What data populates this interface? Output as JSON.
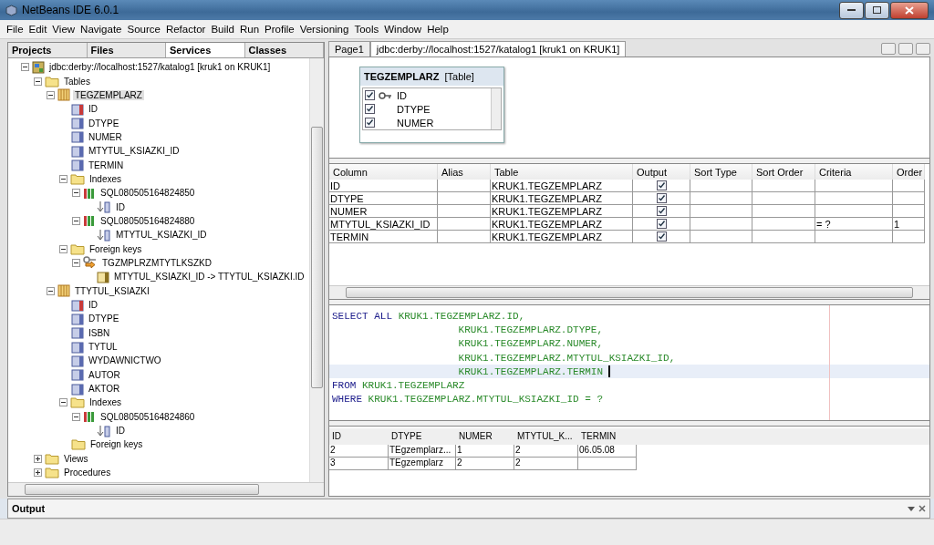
{
  "window": {
    "title": "NetBeans IDE 6.0.1"
  },
  "menu": [
    "File",
    "Edit",
    "View",
    "Navigate",
    "Source",
    "Refactor",
    "Build",
    "Run",
    "Profile",
    "Versioning",
    "Tools",
    "Window",
    "Help"
  ],
  "left_tabs": [
    {
      "label": "Projects",
      "selected": false
    },
    {
      "label": "Files",
      "selected": false
    },
    {
      "label": "Services",
      "selected": true
    },
    {
      "label": "Classes",
      "selected": false
    }
  ],
  "tree": [
    {
      "kind": "connection",
      "label": "jdbc:derby://localhost:1527/katalog1 [kruk1 on KRUK1]",
      "expanded": true,
      "children": [
        {
          "kind": "folder",
          "label": "Tables",
          "expanded": true,
          "children": [
            {
              "kind": "table",
              "label": "TEGZEMPLARZ",
              "expanded": true,
              "selected": true,
              "children": [
                {
                  "kind": "pk_column",
                  "label": "ID"
                },
                {
                  "kind": "column",
                  "label": "DTYPE"
                },
                {
                  "kind": "column",
                  "label": "NUMER"
                },
                {
                  "kind": "column",
                  "label": "MTYTUL_KSIAZKI_ID"
                },
                {
                  "kind": "column",
                  "label": "TERMIN"
                },
                {
                  "kind": "folder",
                  "label": "Indexes",
                  "expanded": true,
                  "children": [
                    {
                      "kind": "index",
                      "label": "SQL080505164824850",
                      "expanded": true,
                      "children": [
                        {
                          "kind": "index_column",
                          "label": "ID"
                        }
                      ]
                    },
                    {
                      "kind": "index",
                      "label": "SQL080505164824880",
                      "expanded": true,
                      "children": [
                        {
                          "kind": "index_column",
                          "label": "MTYTUL_KSIAZKI_ID"
                        }
                      ]
                    }
                  ]
                },
                {
                  "kind": "folder",
                  "label": "Foreign keys",
                  "expanded": true,
                  "children": [
                    {
                      "kind": "fk",
                      "label": "TGZMPLRZMTYTLKSZKD",
                      "expanded": true,
                      "children": [
                        {
                          "kind": "fk_column",
                          "label": "MTYTUL_KSIAZKI_ID -> TTYTUL_KSIAZKI.ID"
                        }
                      ]
                    }
                  ]
                }
              ]
            },
            {
              "kind": "table",
              "label": "TTYTUL_KSIAZKI",
              "expanded": true,
              "selected": false,
              "children": [
                {
                  "kind": "pk_column",
                  "label": "ID"
                },
                {
                  "kind": "column",
                  "label": "DTYPE"
                },
                {
                  "kind": "column",
                  "label": "ISBN"
                },
                {
                  "kind": "column",
                  "label": "TYTUL"
                },
                {
                  "kind": "column",
                  "label": "WYDAWNICTWO"
                },
                {
                  "kind": "column",
                  "label": "AUTOR"
                },
                {
                  "kind": "column",
                  "label": "AKTOR"
                },
                {
                  "kind": "folder",
                  "label": "Indexes",
                  "expanded": true,
                  "children": [
                    {
                      "kind": "index",
                      "label": "SQL080505164824860",
                      "expanded": true,
                      "children": [
                        {
                          "kind": "index_column",
                          "label": "ID"
                        }
                      ]
                    }
                  ]
                },
                {
                  "kind": "folder",
                  "label": "Foreign keys"
                }
              ]
            }
          ]
        },
        {
          "kind": "folder",
          "label": "Views",
          "expanded": false
        },
        {
          "kind": "folder",
          "label": "Procedures",
          "expanded": false
        }
      ]
    }
  ],
  "editor_tabs": [
    {
      "label": "Page1",
      "selected": false
    },
    {
      "label": "jdbc:derby://localhost:1527/katalog1 [kruk1 on KRUK1]",
      "selected": true
    }
  ],
  "diagram": {
    "table": "TEGZEMPLARZ",
    "type": "[Table]",
    "columns": [
      {
        "label": "ID",
        "checked": true,
        "key": true
      },
      {
        "label": "DTYPE",
        "checked": true,
        "key": false
      },
      {
        "label": "NUMER",
        "checked": true,
        "key": false
      }
    ]
  },
  "grid": {
    "columns": [
      "Column",
      "Alias",
      "Table",
      "Output",
      "Sort Type",
      "Sort Order",
      "Criteria",
      "Order"
    ],
    "rows": [
      {
        "column": "ID",
        "alias": "",
        "table": "KRUK1.TEGZEMPLARZ",
        "output": true,
        "criteria": "",
        "order": ""
      },
      {
        "column": "DTYPE",
        "alias": "",
        "table": "KRUK1.TEGZEMPLARZ",
        "output": true,
        "criteria": "",
        "order": ""
      },
      {
        "column": "NUMER",
        "alias": "",
        "table": "KRUK1.TEGZEMPLARZ",
        "output": true,
        "criteria": "",
        "order": ""
      },
      {
        "column": "MTYTUL_KSIAZKI_ID",
        "alias": "",
        "table": "KRUK1.TEGZEMPLARZ",
        "output": true,
        "criteria": "= ?",
        "order": "1"
      },
      {
        "column": "TERMIN",
        "alias": "",
        "table": "KRUK1.TEGZEMPLARZ",
        "output": true,
        "criteria": "",
        "order": ""
      }
    ]
  },
  "sql": [
    {
      "current": false,
      "tokens": [
        {
          "kind": "keyword",
          "text": "SELECT ALL "
        },
        {
          "kind": "ident",
          "text": "KRUK1.TEGZEMPLARZ.ID,"
        }
      ]
    },
    {
      "current": false,
      "tokens": [
        {
          "kind": "ident",
          "text": "                     KRUK1.TEGZEMPLARZ.DTYPE,"
        }
      ]
    },
    {
      "current": false,
      "tokens": [
        {
          "kind": "ident",
          "text": "                     KRUK1.TEGZEMPLARZ.NUMER,"
        }
      ]
    },
    {
      "current": false,
      "tokens": [
        {
          "kind": "ident",
          "text": "                     KRUK1.TEGZEMPLARZ.MTYTUL_KSIAZKI_ID,"
        }
      ]
    },
    {
      "current": true,
      "tokens": [
        {
          "kind": "ident",
          "text": "                     KRUK1.TEGZEMPLARZ.TERMIN"
        }
      ]
    },
    {
      "current": false,
      "tokens": [
        {
          "kind": "keyword",
          "text": "FROM "
        },
        {
          "kind": "ident",
          "text": "KRUK1.TEGZEMPLARZ"
        }
      ]
    },
    {
      "current": false,
      "tokens": [
        {
          "kind": "keyword",
          "text": "WHERE "
        },
        {
          "kind": "ident",
          "text": "KRUK1.TEGZEMPLARZ.MTYTUL_KSIAZKI_ID = ?"
        }
      ]
    }
  ],
  "results": {
    "columns": [
      "ID",
      "DTYPE",
      "NUMER",
      "MTYTUL_K...",
      "TERMIN"
    ],
    "rows": [
      [
        "2",
        "TEgzemplarz...",
        "1",
        "2",
        "06.05.08"
      ],
      [
        "3",
        "TEgzemplarz",
        "2",
        "2",
        ""
      ]
    ]
  },
  "output": {
    "title": "Output"
  }
}
